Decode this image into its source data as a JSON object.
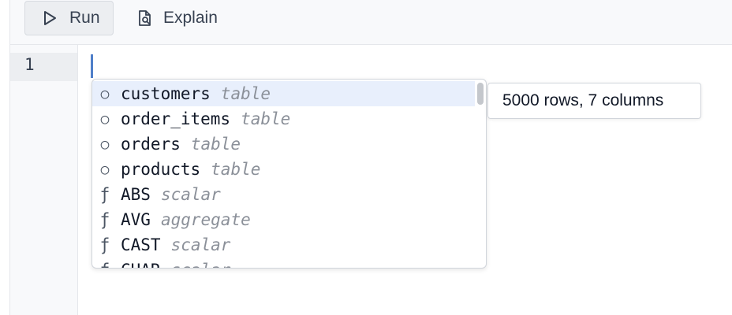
{
  "toolbar": {
    "run_label": "Run",
    "explain_label": "Explain"
  },
  "editor": {
    "line_numbers": [
      "1"
    ],
    "current_text": ""
  },
  "autocomplete": {
    "items": [
      {
        "icon": "table-circle-icon",
        "name": "customers",
        "kind": "table",
        "selected": true
      },
      {
        "icon": "table-circle-icon",
        "name": "order_items",
        "kind": "table"
      },
      {
        "icon": "table-circle-icon",
        "name": "orders",
        "kind": "table"
      },
      {
        "icon": "table-circle-icon",
        "name": "products",
        "kind": "table"
      },
      {
        "icon": "function-icon",
        "name": "ABS",
        "kind": "scalar"
      },
      {
        "icon": "function-icon",
        "name": "AVG",
        "kind": "aggregate"
      },
      {
        "icon": "function-icon",
        "name": "CAST",
        "kind": "scalar"
      },
      {
        "icon": "function-icon",
        "name": "CHAR",
        "kind": "scalar"
      }
    ],
    "info": "5000 rows, 7 columns"
  },
  "glyphs": {
    "table": "○",
    "function": "ƒ"
  },
  "colors": {
    "selected_bg": "#e8effc",
    "cursor": "#4f7fc9"
  }
}
